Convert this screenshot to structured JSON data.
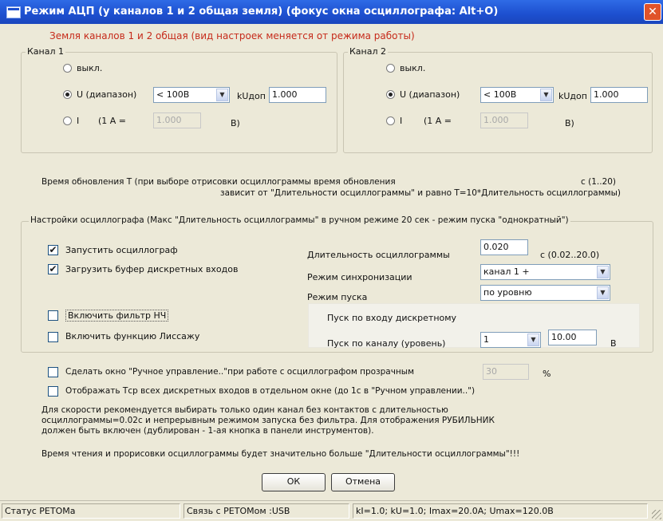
{
  "window": {
    "title": "Режим АЦП (у каналов 1 и 2 общая земля)  (фокус окна осциллографа:  Alt+O)",
    "close": "✕"
  },
  "ground_note": "Земля каналов 1 и 2 общая (вид настроек меняется от режима работы)",
  "channel1": {
    "legend": "Канал 1",
    "off": "выкл.",
    "u_label": "U (диапазон)",
    "u_range": "< 100В",
    "kdop_label": "kUдоп",
    "kdop_value": "1.000",
    "i_label": "I",
    "i_eq": "(1 А =",
    "i_value": "1.000",
    "i_unit": "В)"
  },
  "channel2": {
    "legend": "Канал 2",
    "off": "выкл.",
    "u_label": "U (диапазон)",
    "u_range": "< 100В",
    "kdop_label": "kUдоп",
    "kdop_value": "1.000",
    "i_label": "I",
    "i_eq": "(1 А =",
    "i_value": "1.000",
    "i_unit": "В)"
  },
  "update": {
    "line1": "Время обновления T (при выборе отрисовки осциллограммы время обновления",
    "unit": "с  (1..20)",
    "line2": "зависит от \"Длительности осциллограммы\" и равно T=10*Длительность осциллограммы)"
  },
  "osc": {
    "legend": "Настройки осциллографа (Макс \"Длительность осциллограммы\" в ручном режиме 20 сек - режим пуска \"однократный\")",
    "start_label": "Запустить осциллограф",
    "start_checked": true,
    "buffer_label": "Загрузить буфер дискретных входов",
    "buffer_checked": true,
    "lpf_label": "Включить фильтр НЧ",
    "lpf_checked": false,
    "lissajous_label": "Включить функцию Лиссажу",
    "lissajous_checked": false,
    "duration_label": "Длительность осциллограммы",
    "duration_value": "0.020",
    "duration_range": "с  (0.02..20.0)",
    "sync_label": "Режим синхронизации",
    "sync_value": "канал 1 +",
    "trigger_label": "Режим пуска",
    "trigger_value": "по уровню",
    "discrete_label": "Пуск по входу дискретному",
    "channel_level_label": "Пуск по каналу (уровень)",
    "channel_value": "1",
    "level_value": "10.00",
    "level_unit": "В"
  },
  "transparent": {
    "label": "Сделать окно \"Ручное управление..\"при работе с осциллографом прозрачным",
    "value": "30",
    "unit": "%"
  },
  "show_tsp_label": "Отображать Тср всех дискретных входов в отдельном окне (до 1с в \"Ручном управлении..\")",
  "advice": {
    "line1": "Для скорости рекомендуется выбирать только один канал без контактов с длительностью",
    "line2": "осциллограммы=0.02с и непрерывным режимом запуска без фильтра.  Для отображения РУБИЛЬНИК",
    "line3": "должен быть включен (дублирован - 1-ая кнопка в панели инструментов)."
  },
  "read_time_note": "Время чтения и прорисовки осциллограммы будет значительно больше \"Длительности осциллограммы\"!!!",
  "buttons": {
    "ok": "ОК",
    "cancel": "Отмена"
  },
  "status": {
    "left": "Статус РЕТОМа",
    "conn": "Связь с РЕТОМом :USB",
    "params": "kI=1.0; kU=1.0; Imax=20.0A; Umax=120.0B"
  }
}
